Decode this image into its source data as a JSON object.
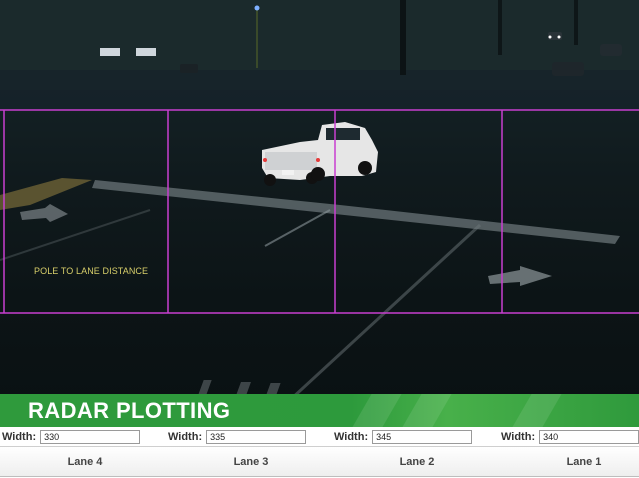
{
  "overlay": {
    "pole_label": "POLE TO LANE DISTANCE",
    "grid_color": "#c83fd0"
  },
  "banner": {
    "title": "RADAR PLOTTING",
    "color": "#2f9a3c"
  },
  "widths": [
    {
      "label": "Width:",
      "value": "330"
    },
    {
      "label": "Width:",
      "value": "335"
    },
    {
      "label": "Width:",
      "value": "345"
    },
    {
      "label": "Width:",
      "value": "340"
    }
  ],
  "lanes": [
    {
      "label": "Lane 4"
    },
    {
      "label": "Lane 3"
    },
    {
      "label": "Lane 2"
    },
    {
      "label": "Lane 1"
    }
  ]
}
